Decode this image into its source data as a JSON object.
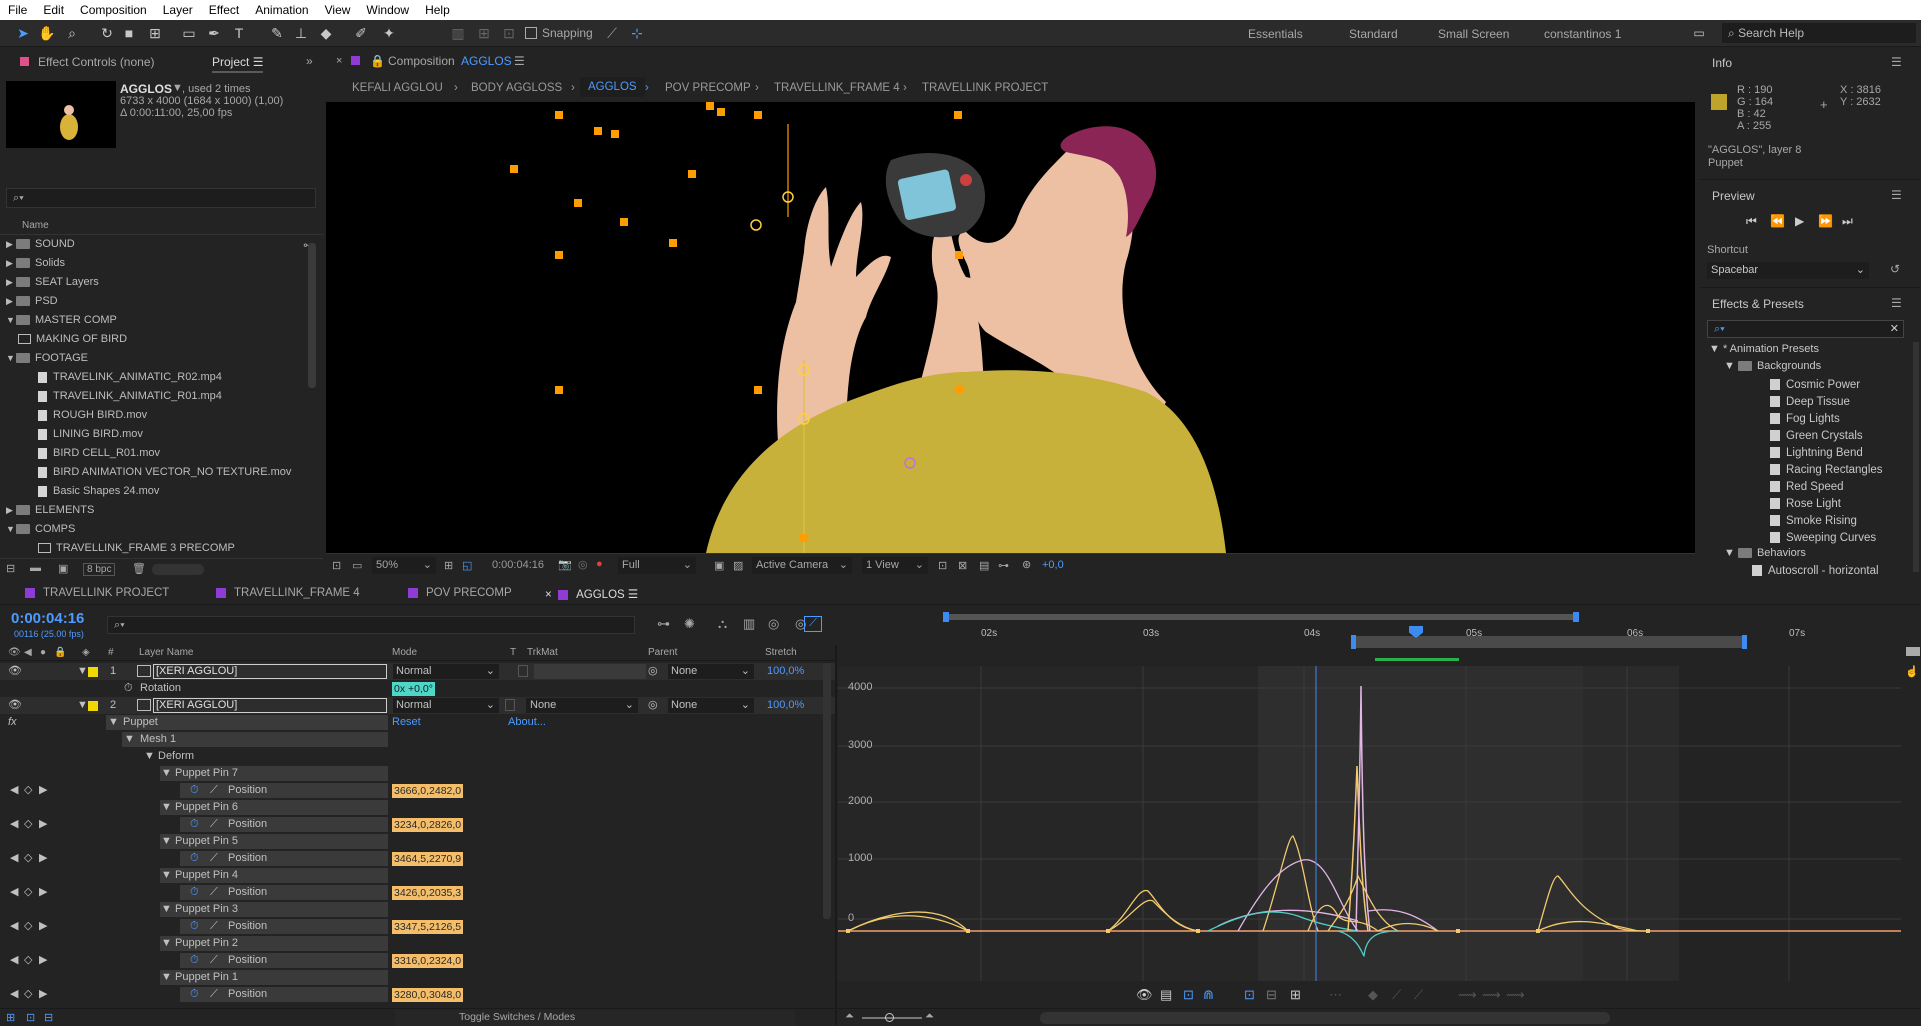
{
  "menu": [
    "File",
    "Edit",
    "Composition",
    "Layer",
    "Effect",
    "Animation",
    "View",
    "Window",
    "Help"
  ],
  "toolbar": {
    "snapping_label": "Snapping",
    "workspaces": [
      "Essentials",
      "Standard",
      "Small Screen",
      "constantinos 1"
    ],
    "search_placeholder": "Search Help"
  },
  "project_panel": {
    "tab_effect_controls": "Effect Controls (none)",
    "tab_project": "Project",
    "comp_name": "AGGLOS",
    "used_text": ", used 2 times",
    "dims": "6733 x 4000  (1684 x 1000) (1,00)",
    "duration": "Δ 0:00:11:00, 25,00 fps",
    "column_name": "Name",
    "items": [
      {
        "label": "SOUND",
        "type": "folder",
        "indent": 0,
        "open": false
      },
      {
        "label": "Solids",
        "type": "folder",
        "indent": 0,
        "open": false
      },
      {
        "label": "SEAT Layers",
        "type": "folder",
        "indent": 0,
        "open": false
      },
      {
        "label": "PSD",
        "type": "folder",
        "indent": 0,
        "open": false
      },
      {
        "label": "MASTER COMP",
        "type": "folder",
        "indent": 0,
        "open": true
      },
      {
        "label": "MAKING OF BIRD",
        "type": "comp",
        "indent": 1,
        "open": null
      },
      {
        "label": "FOOTAGE",
        "type": "folder",
        "indent": 0,
        "open": true
      },
      {
        "label": "TRAVELINK_ANIMATIC_R02.mp4",
        "type": "file",
        "indent": 2,
        "open": null
      },
      {
        "label": "TRAVELINK_ANIMATIC_R01.mp4",
        "type": "file",
        "indent": 2,
        "open": null
      },
      {
        "label": "ROUGH BIRD.mov",
        "type": "file",
        "indent": 2,
        "open": null
      },
      {
        "label": "LINING BIRD.mov",
        "type": "file",
        "indent": 2,
        "open": null
      },
      {
        "label": "BIRD CELL_R01.mov",
        "type": "file",
        "indent": 2,
        "open": null
      },
      {
        "label": "BIRD ANIMATION VECTOR_NO TEXTURE.mov",
        "type": "file",
        "indent": 2,
        "open": null
      },
      {
        "label": "Basic Shapes 24.mov",
        "type": "file",
        "indent": 2,
        "open": null
      },
      {
        "label": "ELEMENTS",
        "type": "folder",
        "indent": 0,
        "open": false
      },
      {
        "label": "COMPS",
        "type": "folder",
        "indent": 0,
        "open": true
      },
      {
        "label": "TRAVELLINK_FRAME 3 PRECOMP",
        "type": "comp",
        "indent": 2,
        "open": null
      }
    ],
    "bpc": "8 bpc"
  },
  "composition": {
    "title_prefix": "Composition",
    "title_name": "AGGLOS",
    "breadcrumbs": [
      "KEFALI AGGLOU",
      "BODY AGGLOSS",
      "AGGLOS",
      "POV PRECOMP",
      "TRAVELLINK_FRAME 4",
      "TRAVELLINK PROJECT"
    ],
    "active_crumb": "AGGLOS",
    "zoom": "50%",
    "timecode": "0:00:04:16",
    "resolution": "Full",
    "camera": "Active Camera",
    "views": "1 View",
    "exposure": "+0,0"
  },
  "info": {
    "title": "Info",
    "r": "R : 190",
    "g": "G : 164",
    "b": "B : 42",
    "a": "A : 255",
    "x": "X : 3816",
    "y": "Y : 2632",
    "swatch": "#bea42a",
    "layer_line": "\"AGGLOS\", layer 8",
    "effect_line": "Puppet"
  },
  "preview": {
    "title": "Preview",
    "shortcut_label": "Shortcut",
    "shortcut_value": "Spacebar"
  },
  "effects_presets": {
    "title": "Effects & Presets",
    "root": "* Animation Presets",
    "folder1": "Backgrounds",
    "items": [
      "Cosmic Power",
      "Deep Tissue",
      "Fog Lights",
      "Green Crystals",
      "Lightning Bend",
      "Racing Rectangles",
      "Red Speed",
      "Rose Light",
      "Smoke Rising",
      "Sweeping Curves"
    ],
    "folder2": "Behaviors",
    "item_after": "Autoscroll - horizontal"
  },
  "timeline": {
    "tabs": [
      {
        "label": "TRAVELLINK PROJECT",
        "color": "#8f3cd6"
      },
      {
        "label": "TRAVELLINK_FRAME 4",
        "color": "#8f3cd6"
      },
      {
        "label": "POV PRECOMP",
        "color": "#8f3cd6"
      },
      {
        "label": "AGGLOS",
        "color": "#8f3cd6"
      }
    ],
    "timecode": "0:00:04:16",
    "frames": "00116 (25.00 fps)",
    "columns": {
      "num": "#",
      "layer": "Layer Name",
      "mode": "Mode",
      "t": "T",
      "trkmat": "TrkMat",
      "parent": "Parent",
      "stretch": "Stretch"
    },
    "layer1": {
      "num": "1",
      "name": "[XERI AGGLOU]",
      "mode": "Normal",
      "parent": "None",
      "stretch": "100,0%"
    },
    "rotation_label": "Rotation",
    "rotation_value": "0x +0,0°",
    "layer2": {
      "num": "2",
      "name": "[XERI AGGLOU]",
      "mode": "Normal",
      "trkmat": "None",
      "parent": "None",
      "stretch": "100,0%"
    },
    "puppet": "Puppet",
    "reset": "Reset",
    "about": "About...",
    "mesh": "Mesh 1",
    "deform": "Deform",
    "position_label": "Position",
    "pins": [
      {
        "name": "Puppet Pin 7",
        "value": "3666,0,2482,0"
      },
      {
        "name": "Puppet Pin 6",
        "value": "3234,0,2826,0"
      },
      {
        "name": "Puppet Pin 5",
        "value": "3464,5,2270,9"
      },
      {
        "name": "Puppet Pin 4",
        "value": "3426,0,2035,3"
      },
      {
        "name": "Puppet Pin 3",
        "value": "3347,5,2126,5"
      },
      {
        "name": "Puppet Pin 2",
        "value": "3316,0,2324,0"
      },
      {
        "name": "Puppet Pin 1",
        "value": "3280,0,3048,0"
      }
    ],
    "toggle_label": "Toggle Switches / Modes",
    "ruler_ticks": [
      "02s",
      "03s",
      "04s",
      "05s",
      "06s",
      "07s"
    ],
    "y_ticks": [
      "4000",
      "3000",
      "2000",
      "1000",
      "0"
    ]
  },
  "colors": {
    "accent_blue": "#3d8bf0",
    "keyframe_orange": "#ff9d00",
    "graph_yellow": "#f3c96e",
    "graph_pink": "#e3b6e6",
    "graph_cyan": "#4fd0c8",
    "shirt": "#c8b13a",
    "skin": "#edc0a3",
    "hair": "#8a2556"
  }
}
